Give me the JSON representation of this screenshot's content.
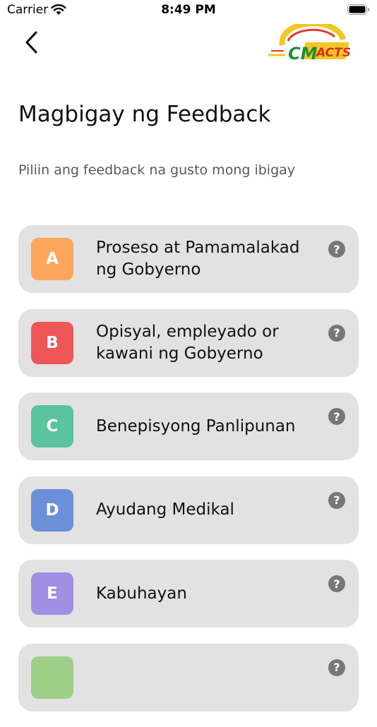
{
  "status": {
    "carrier": "Carrier",
    "time": "8:49 PM"
  },
  "header": {
    "title": "Magbigay ng Feedback",
    "subtitle": "Piliin ang feedback na gusto mong ibigay"
  },
  "logo": {
    "text": "CM ACTS"
  },
  "help_symbol": "?",
  "options": [
    {
      "letter": "A",
      "label": "Proseso at Pamamalakad ng Gobyerno",
      "color": "#fca65c"
    },
    {
      "letter": "B",
      "label": "Opisyal, empleyado or kawani ng Gobyerno",
      "color": "#ef5657"
    },
    {
      "letter": "C",
      "label": "Benepisyong Panlipunan",
      "color": "#5cc39f"
    },
    {
      "letter": "D",
      "label": "Ayudang Medikal",
      "color": "#6b8fd8"
    },
    {
      "letter": "E",
      "label": "Kabuhayan",
      "color": "#a08fe3"
    },
    {
      "letter": "",
      "label": "",
      "color": "#9fd08a"
    }
  ]
}
